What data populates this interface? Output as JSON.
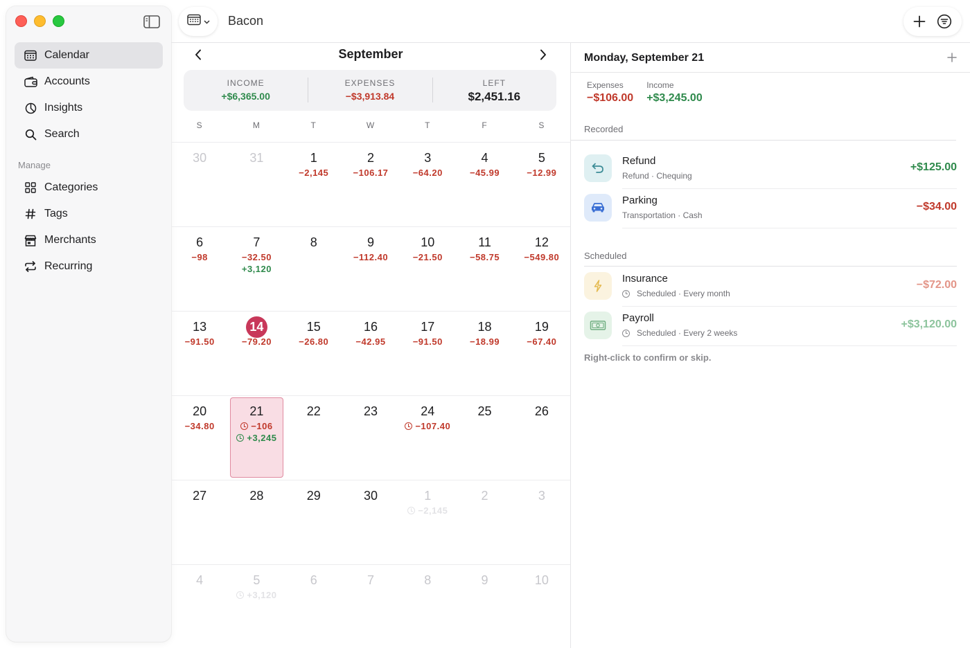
{
  "app": {
    "title": "Bacon"
  },
  "sidebar": {
    "items": [
      {
        "label": "Calendar",
        "icon": "calendar-icon",
        "active": true
      },
      {
        "label": "Accounts",
        "icon": "wallet-icon"
      },
      {
        "label": "Insights",
        "icon": "pie-chart-icon"
      },
      {
        "label": "Search",
        "icon": "search-icon"
      }
    ],
    "manage_label": "Manage",
    "manage_items": [
      {
        "label": "Categories",
        "icon": "grid-icon"
      },
      {
        "label": "Tags",
        "icon": "hashtag-icon"
      },
      {
        "label": "Merchants",
        "icon": "storefront-icon"
      },
      {
        "label": "Recurring",
        "icon": "repeat-icon"
      }
    ]
  },
  "calendar": {
    "month": "September",
    "summary": {
      "income_label": "INCOME",
      "income": "+$6,365.00",
      "expenses_label": "EXPENSES",
      "expenses": "−$3,913.84",
      "left_label": "LEFT",
      "left": "$2,451.16"
    },
    "weekdays": [
      "S",
      "M",
      "T",
      "W",
      "T",
      "F",
      "S"
    ],
    "weeks": [
      [
        {
          "n": "30",
          "muted": true
        },
        {
          "n": "31",
          "muted": true
        },
        {
          "n": "1",
          "exp": "−2,145"
        },
        {
          "n": "2",
          "exp": "−106.17"
        },
        {
          "n": "3",
          "exp": "−64.20"
        },
        {
          "n": "4",
          "exp": "−45.99"
        },
        {
          "n": "5",
          "exp": "−12.99"
        }
      ],
      [
        {
          "n": "6",
          "exp": "−98"
        },
        {
          "n": "7",
          "exp": "−32.50",
          "inc": "+3,120"
        },
        {
          "n": "8"
        },
        {
          "n": "9",
          "exp": "−112.40"
        },
        {
          "n": "10",
          "exp": "−21.50"
        },
        {
          "n": "11",
          "exp": "−58.75"
        },
        {
          "n": "12",
          "exp": "−549.80"
        }
      ],
      [
        {
          "n": "13",
          "exp": "−91.50"
        },
        {
          "n": "14",
          "exp": "−79.20",
          "today": true
        },
        {
          "n": "15",
          "exp": "−26.80"
        },
        {
          "n": "16",
          "exp": "−42.95"
        },
        {
          "n": "17",
          "exp": "−91.50"
        },
        {
          "n": "18",
          "exp": "−18.99"
        },
        {
          "n": "19",
          "exp": "−67.40"
        }
      ],
      [
        {
          "n": "20",
          "exp": "−34.80"
        },
        {
          "n": "21",
          "exp": "−106",
          "inc": "+3,245",
          "scheduled": true,
          "selected": true
        },
        {
          "n": "22"
        },
        {
          "n": "23"
        },
        {
          "n": "24",
          "exp": "−107.40",
          "scheduled": true
        },
        {
          "n": "25"
        },
        {
          "n": "26"
        }
      ],
      [
        {
          "n": "27"
        },
        {
          "n": "28"
        },
        {
          "n": "29"
        },
        {
          "n": "30"
        },
        {
          "n": "1",
          "muted": true,
          "exp": "−2,145",
          "scheduled": true
        },
        {
          "n": "2",
          "muted": true
        },
        {
          "n": "3",
          "muted": true
        }
      ],
      [
        {
          "n": "4",
          "muted": true
        },
        {
          "n": "5",
          "muted": true,
          "inc": "+3,120",
          "scheduled": true
        },
        {
          "n": "6",
          "muted": true
        },
        {
          "n": "7",
          "muted": true
        },
        {
          "n": "8",
          "muted": true
        },
        {
          "n": "9",
          "muted": true
        },
        {
          "n": "10",
          "muted": true
        }
      ]
    ]
  },
  "detail": {
    "title": "Monday, September 21",
    "expenses_label": "Expenses",
    "expenses": "−$106.00",
    "income_label": "Income",
    "income": "+$3,245.00",
    "recorded_label": "Recorded",
    "recorded": [
      {
        "title": "Refund",
        "sub": "Refund · Chequing",
        "amount": "+$125.00",
        "icon": "undo-arrow-icon",
        "type": "inc"
      },
      {
        "title": "Parking",
        "sub": "Transportation · Cash",
        "amount": "−$34.00",
        "icon": "car-icon",
        "type": "exp"
      }
    ],
    "scheduled_label": "Scheduled",
    "scheduled": [
      {
        "title": "Insurance",
        "sub": "Scheduled · Every month",
        "amount": "−$72.00",
        "icon": "lightning-icon",
        "type": "exp"
      },
      {
        "title": "Payroll",
        "sub": "Scheduled · Every 2 weeks",
        "amount": "+$3,120.00",
        "icon": "banknote-icon",
        "type": "inc"
      }
    ],
    "hint": "Right-click to confirm or skip."
  },
  "colors": {
    "accent": "#c8385a",
    "expense": "#c0392b",
    "income": "#2f8a4c",
    "selected_bg": "#f9dde4"
  }
}
